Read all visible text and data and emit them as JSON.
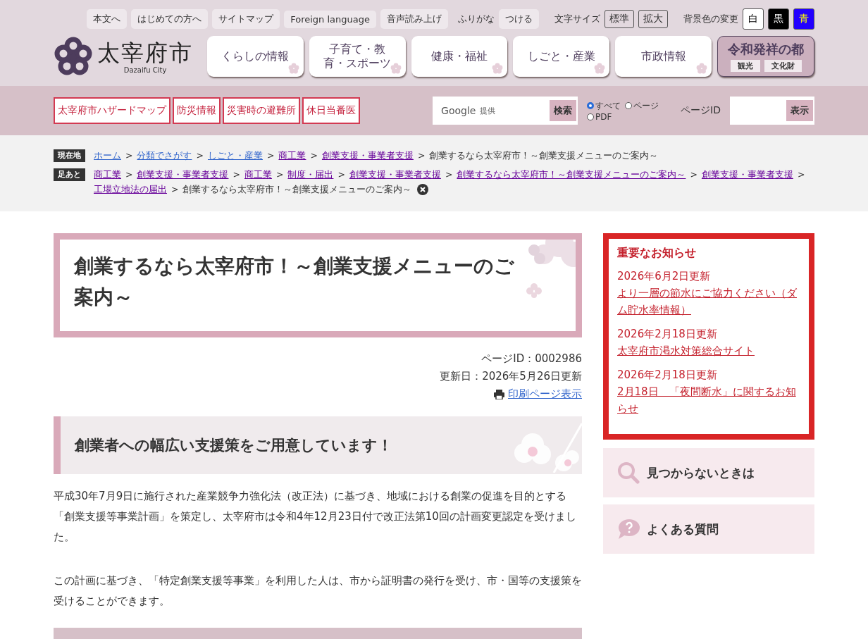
{
  "utility_links": [
    {
      "label": "本文へ"
    },
    {
      "label": "はじめての方へ"
    },
    {
      "label": "サイトマップ"
    },
    {
      "label": "Foreign language"
    },
    {
      "label": "音声読み上げ"
    }
  ],
  "furigana": {
    "label": "ふりがな",
    "button": "つける"
  },
  "font_size": {
    "label": "文字サイズ",
    "buttons": [
      {
        "label": "標準"
      },
      {
        "label": "拡大"
      }
    ]
  },
  "background_color": {
    "label": "背景色の変更",
    "buttons": [
      {
        "label": "白",
        "color": "#ffffff"
      },
      {
        "label": "黒",
        "color": "#000000"
      },
      {
        "label": "青",
        "color": "#2200ff"
      }
    ]
  },
  "logo": {
    "title": "太宰府市",
    "subtitle": "Dazaifu City"
  },
  "main_nav": [
    {
      "label": "くらしの情報"
    },
    {
      "label": "子育て・教育・スポーツ"
    },
    {
      "label": "健康・福祉"
    },
    {
      "label": "しごと・産業"
    },
    {
      "label": "市政情報"
    }
  ],
  "reiwa_banner": {
    "title": "令和発祥の都",
    "links": [
      "観光",
      "文化財"
    ]
  },
  "emergency_links": [
    "太宰府市ハザードマップ",
    "防災情報",
    "災害時の避難所",
    "休日当番医"
  ],
  "search": {
    "provider": "Google",
    "provider_note": "提供",
    "button": "検索",
    "scopes": [
      {
        "label": "すべて",
        "selected": true
      },
      {
        "label": "ページ",
        "selected": false
      },
      {
        "label": "PDF",
        "selected": false
      }
    ]
  },
  "page_id_search": {
    "label": "ページID",
    "button": "表示"
  },
  "breadcrumb": {
    "label": "現在地",
    "separator": ">",
    "items": [
      {
        "text": "ホーム",
        "kind": "link"
      },
      {
        "text": "分類でさがす",
        "kind": "link"
      },
      {
        "text": "しごと・産業",
        "kind": "link"
      },
      {
        "text": "商工業",
        "kind": "visited"
      },
      {
        "text": "創業支援・事業者支援",
        "kind": "visited"
      },
      {
        "text": "創業するなら太宰府市！～創業支援メニューのご案内～",
        "kind": "current"
      }
    ]
  },
  "footprints": {
    "label": "足あと",
    "separator": ">",
    "items": [
      {
        "text": "商工業",
        "kind": "visited"
      },
      {
        "text": "創業支援・事業者支援",
        "kind": "visited"
      },
      {
        "text": "商工業",
        "kind": "visited"
      },
      {
        "text": "制度・届出",
        "kind": "visited"
      },
      {
        "text": "創業支援・事業者支援",
        "kind": "visited"
      },
      {
        "text": "創業するなら太宰府市！～創業支援メニューのご案内～",
        "kind": "visited"
      },
      {
        "text": "創業支援・事業者支援",
        "kind": "visited"
      },
      {
        "text": "工場立地法の届出",
        "kind": "visited"
      },
      {
        "text": "創業するなら太宰府市！～創業支援メニューのご案内～",
        "kind": "current"
      }
    ]
  },
  "page_title": "創業するなら太宰府市！～創業支援メニューのご案内～",
  "page_meta": {
    "page_id": "ページID：0002986",
    "updated": "更新日：2026年5月26日更新",
    "print_link": "印刷ページ表示"
  },
  "section_heading": "創業者への幅広い支援策をご用意しています！",
  "paragraphs": [
    "平成30年7月9日に施行された産業競争力強化法（改正法）に基づき、地域における創業の促進を目的とする「創業支援等事業計画」を策定し、太宰府市は令和4年12月23日付で改正法第10回の計画変更認定を受けました。",
    "この計画に基づき、「特定創業支援等事業」を利用した人は、市から証明書の発行を受け、市・国等の支援策を受けることができます。"
  ],
  "important_notices": {
    "title": "重要なお知らせ",
    "items": [
      {
        "date": "2026年6月2日更新",
        "link": "より一層の節水にご協力ください（ダム貯水率情報）"
      },
      {
        "date": "2026年2月18日更新",
        "link": "太宰府市渇水対策総合サイト"
      },
      {
        "date": "2026年2月18日更新",
        "link": "2月18日　「夜間断水」に関するお知らせ"
      }
    ]
  },
  "side_links": [
    {
      "label": "見つからないときは",
      "kind": "search"
    },
    {
      "label": "よくある質問",
      "kind": "faq"
    }
  ]
}
